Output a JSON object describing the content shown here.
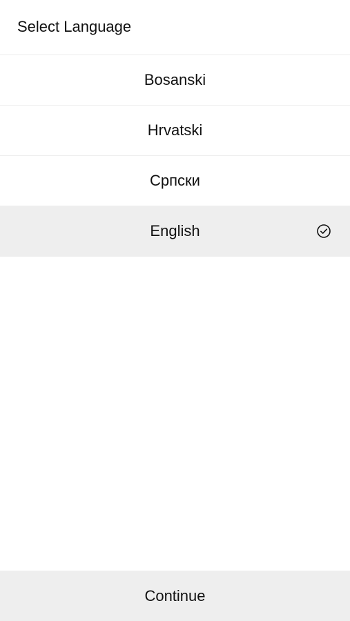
{
  "header": {
    "title": "Select Language"
  },
  "languages": [
    {
      "label": "Bosanski",
      "selected": false
    },
    {
      "label": "Hrvatski",
      "selected": false
    },
    {
      "label": "Српски",
      "selected": false
    },
    {
      "label": "English",
      "selected": true
    }
  ],
  "selected_icon": "check-circle-icon",
  "footer": {
    "continue_label": "Continue"
  }
}
